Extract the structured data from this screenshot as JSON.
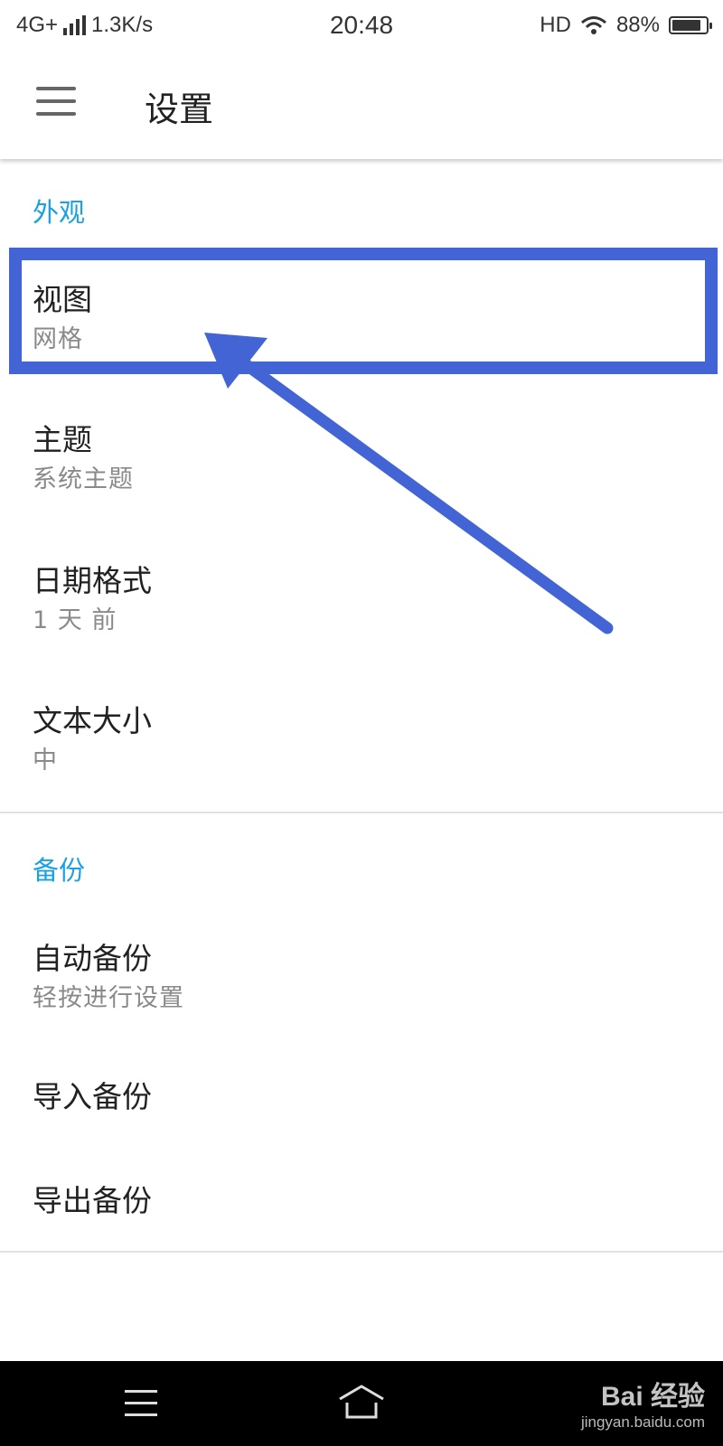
{
  "status_bar": {
    "network": "4G+",
    "speed": "1.3K/s",
    "time": "20:48",
    "hd": "HD",
    "battery": "88%",
    "battery_level": 0.88,
    "icons": [
      "signal-icon",
      "wifi-icon",
      "battery-icon"
    ]
  },
  "app_bar": {
    "title": "设置",
    "menu_icon": "hamburger-menu-icon"
  },
  "sections": {
    "appearance": {
      "header": "外观",
      "items": [
        {
          "title": "视图",
          "summary": "网格"
        },
        {
          "title": "主题",
          "summary": "系统主题"
        },
        {
          "title": "日期格式",
          "summary": "1 天 前"
        },
        {
          "title": "文本大小",
          "summary": "中"
        }
      ]
    },
    "backup": {
      "header": "备份",
      "items": [
        {
          "title": "自动备份",
          "summary": "轻按进行设置"
        },
        {
          "title": "导入备份"
        },
        {
          "title": "导出备份"
        }
      ]
    }
  },
  "colors": {
    "accent": "#1ba1e2",
    "annotation": "#4264d4",
    "primary_text": "#212121",
    "secondary_text": "#8a8a8a"
  },
  "nav_bar": {
    "icons": [
      "nav-menu-icon",
      "nav-home-icon"
    ]
  },
  "watermark": {
    "brand": "Bai 经验",
    "site": "jingyan.baidu.com"
  }
}
